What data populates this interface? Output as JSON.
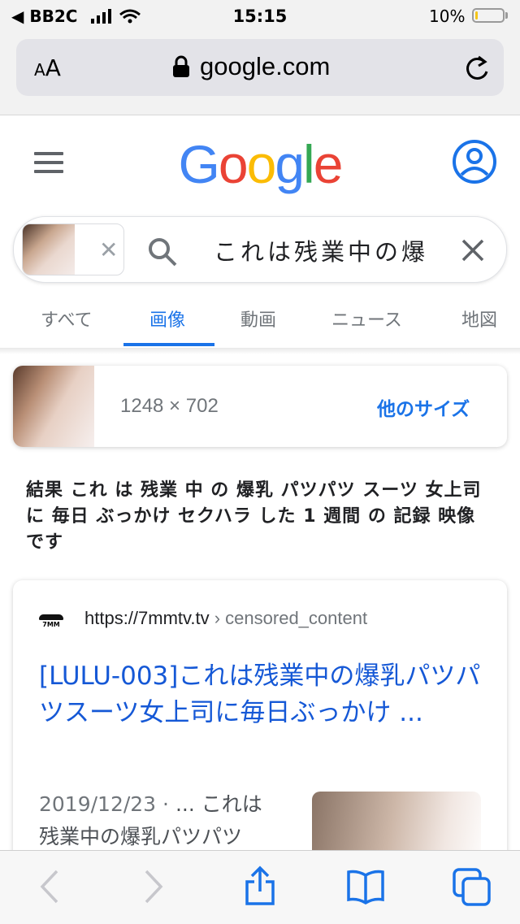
{
  "status_bar": {
    "carrier": "BB2C",
    "time": "15:15",
    "battery_percent": "10%",
    "battery_level": 0.1
  },
  "browser": {
    "text_size_small": "A",
    "text_size_big": "A",
    "domain": "google.com"
  },
  "google": {
    "logo_letters": [
      {
        "char": "G",
        "color": "#4285F4"
      },
      {
        "char": "o",
        "color": "#EA4335"
      },
      {
        "char": "o",
        "color": "#FBBC05"
      },
      {
        "char": "g",
        "color": "#4285F4"
      },
      {
        "char": "l",
        "color": "#34A853"
      },
      {
        "char": "e",
        "color": "#EA4335"
      }
    ]
  },
  "search": {
    "query": "これは残業中の爆"
  },
  "tabs": [
    {
      "label": "すべて",
      "active": false
    },
    {
      "label": "画像",
      "active": true
    },
    {
      "label": "動画",
      "active": false
    },
    {
      "label": "ニュース",
      "active": false
    },
    {
      "label": "地図",
      "active": false
    }
  ],
  "image_card": {
    "dimensions": "1248 × 702",
    "more_sizes": "他のサイズ"
  },
  "related_query": "結果 これ は 残業 中 の 爆乳 パツパツ スーツ 女上司 に 毎日 ぶっかけ セクハラ した 1 週間 の 記録 映像 です",
  "result": {
    "favicon_text": "7MM",
    "site_url": "https://7mmtv.tv",
    "site_path": " › censored_content",
    "title": "[LULU-003]これは残業中の爆乳パツパツスーツ女上司に毎日ぶっかけ ...",
    "date": "2019/12/23 · ",
    "snippet": "... これは残業中の爆乳パツパツ"
  },
  "colors": {
    "link_blue": "#1a73e8",
    "title_blue": "#1558d6",
    "icon_blue": "#1a73e8"
  }
}
